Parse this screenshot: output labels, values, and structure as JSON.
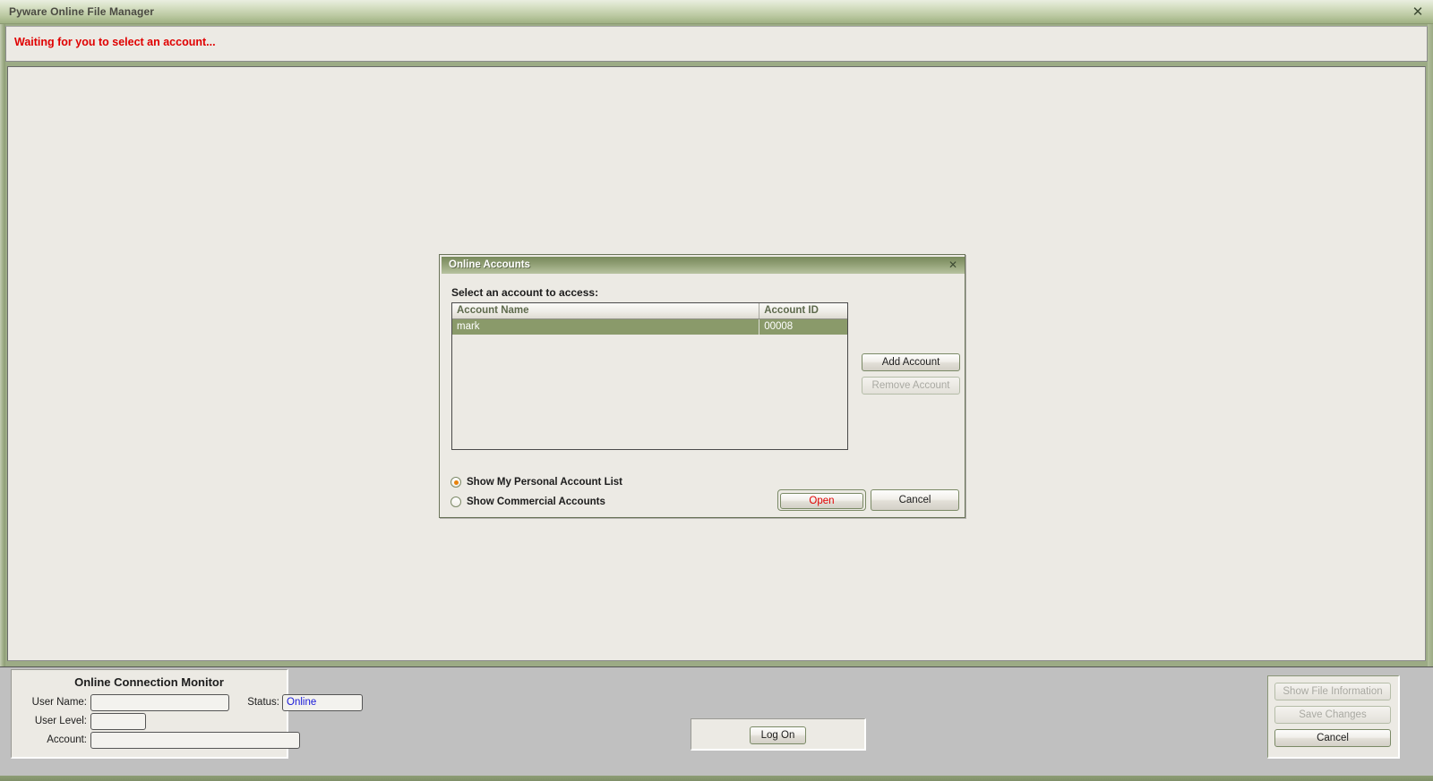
{
  "window": {
    "title": "Pyware Online File Manager",
    "close_icon": "close-icon",
    "close_glyph": "✕"
  },
  "status": {
    "message": "Waiting for you to select an account...",
    "color": "#e00000"
  },
  "dialog": {
    "title": "Online Accounts",
    "close_glyph": "✕",
    "prompt": "Select an account to access:",
    "table": {
      "columns": [
        "Account Name",
        "Account ID"
      ],
      "rows": [
        {
          "name": "mark",
          "id": "00008",
          "selected": true
        }
      ],
      "selection_color": "#8a9a6a",
      "header_text_color": "#5e6a4d"
    },
    "side_buttons": [
      {
        "label": "Add Account",
        "enabled": true
      },
      {
        "label": "Remove Account",
        "enabled": false
      }
    ],
    "radios": [
      {
        "label": "Show My Personal Account List",
        "selected": true
      },
      {
        "label": "Show Commercial Accounts",
        "selected": false
      }
    ],
    "open_button": {
      "label": "Open",
      "color": "#e00000",
      "is_default": true
    },
    "cancel_button": {
      "label": "Cancel"
    }
  },
  "monitor": {
    "title": "Online Connection Monitor",
    "user_name_label": "User Name:",
    "user_name_value": "",
    "user_level_label": "User Level:",
    "user_level_value": "",
    "account_label": "Account:",
    "account_value": "",
    "status_label": "Status:",
    "status_value": "Online",
    "status_color": "#1818d8"
  },
  "logon": {
    "label": "Log On"
  },
  "right_actions": [
    {
      "label": "Show File Information",
      "enabled": false
    },
    {
      "label": "Save Changes",
      "enabled": false
    },
    {
      "label": "Cancel",
      "enabled": true
    }
  ]
}
